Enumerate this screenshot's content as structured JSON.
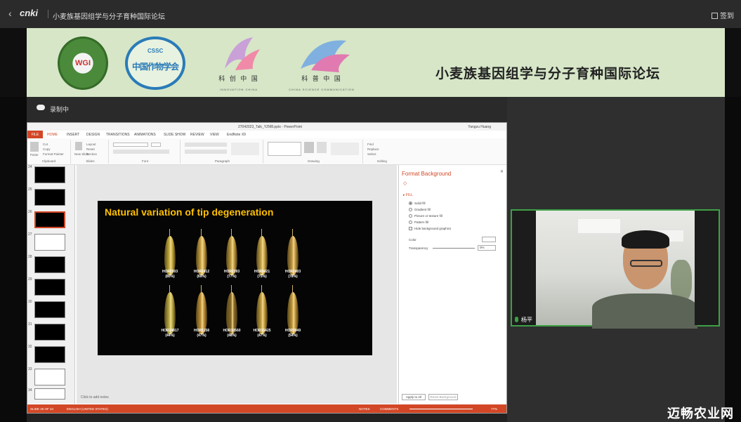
{
  "topbar": {
    "back_icon": "chevron-left-icon",
    "logo": "cnki",
    "title": "小麦族基因组学与分子育种国际论坛",
    "checkin_label": "签到"
  },
  "banner": {
    "logo1_text": "WGI",
    "logo2_text_top": "CSSC",
    "logo2_text": "中国作物学会",
    "logo3_text": "科 创 中 国",
    "logo3_sub": "INNOVATION CHINA",
    "logo4_text": "科 普 中 国",
    "logo4_sub": "CHINA SCIENCE COMMUNICATION",
    "title": "小麦族基因组学与分子育种国际论坛"
  },
  "recording": {
    "label": "录制中"
  },
  "ppt": {
    "window_title": "27042023_Talk_YZM8.pptx - PowerPoint",
    "user": "Yangzu Huang",
    "tabs": [
      "FILE",
      "HOME",
      "INSERT",
      "DESIGN",
      "TRANSITIONS",
      "ANIMATIONS",
      "SLIDE SHOW",
      "REVIEW",
      "VIEW",
      "EndNote X9"
    ],
    "ribbon_groups": [
      "Clipboard",
      "Slides",
      "Font",
      "Paragraph",
      "Drawing",
      "Editing"
    ],
    "clipboard_items": [
      "Paste",
      "Cut",
      "Copy",
      "Format Painter"
    ],
    "slides_items": [
      "New Slide",
      "Layout",
      "Reset",
      "Section"
    ],
    "editing_items": [
      "Find",
      "Replace",
      "Select"
    ],
    "thumb_numbers": [
      "24",
      "25",
      "26",
      "27",
      "28",
      "29",
      "30",
      "31",
      "32",
      "33",
      "34"
    ],
    "notes_placeholder": "Click to add notes",
    "status": {
      "slide": "SLIDE 26 OF 34",
      "language": "ENGLISH (UNITED STATES)",
      "notes": "NOTES",
      "comments": "COMMENTS",
      "zoom": "77%"
    }
  },
  "slide": {
    "title": "Natural variation of tip degeneration",
    "row1": [
      {
        "name": "HOR2503",
        "pct": "(80%)"
      },
      {
        "name": "HOR2412",
        "pct": "(69%)"
      },
      {
        "name": "HOR2393",
        "pct": "(77%)"
      },
      {
        "name": "HOR9421",
        "pct": "(75%)"
      },
      {
        "name": "HOR2403",
        "pct": "(78%)"
      }
    ],
    "row2": [
      {
        "name": "HOR14817",
        "pct": "(44%)"
      },
      {
        "name": "HOR1158",
        "pct": "(47%)"
      },
      {
        "name": "HOR10560",
        "pct": "(48%)"
      },
      {
        "name": "HOR15425",
        "pct": "(47%)"
      },
      {
        "name": "HOR3949",
        "pct": "(54%)"
      }
    ]
  },
  "format_pane": {
    "title": "Format Background",
    "section": "FILL",
    "options": [
      "Solid fill",
      "Gradient fill",
      "Picture or texture fill",
      "Pattern fill",
      "Hide background graphics"
    ],
    "color_label": "Color",
    "transparency_label": "Transparency",
    "transparency_value": "0%",
    "apply_all": "Apply to All",
    "reset_bg": "Reset Background"
  },
  "video": {
    "speaker_name": "杨平"
  },
  "watermark": "迈畅农业网",
  "colors": {
    "ppt_accent": "#d24726",
    "banner_bg": "#d6e6c7",
    "slide_title": "#ffc000",
    "video_border": "#3ea045"
  }
}
